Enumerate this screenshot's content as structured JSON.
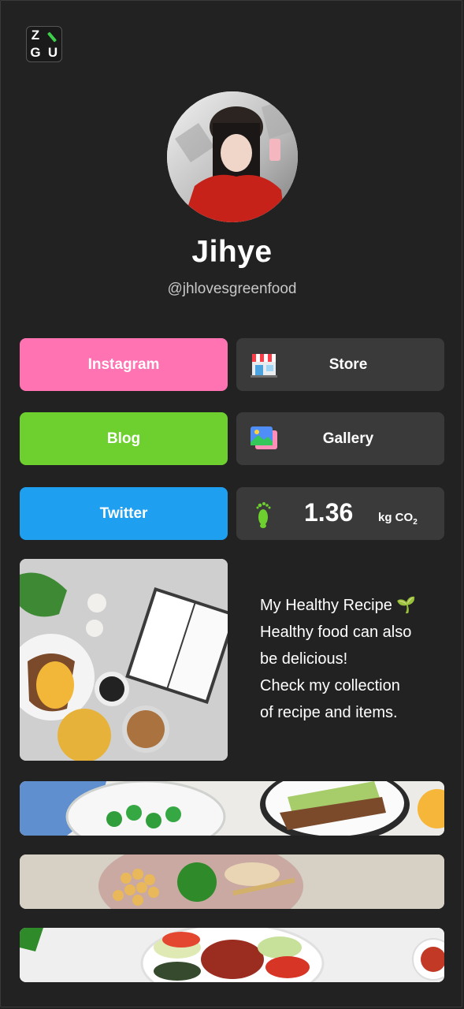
{
  "logo": {
    "letters": [
      "Z",
      "",
      "G",
      "U"
    ]
  },
  "profile": {
    "name": "Jihye",
    "handle": "@jhlovesgreenfood"
  },
  "links": {
    "instagram": "Instagram",
    "blog": "Blog",
    "twitter": "Twitter",
    "store": "Store",
    "gallery": "Gallery"
  },
  "footprint": {
    "value": "1.36",
    "unit": "kg CO",
    "unit_sub": "2"
  },
  "feature": {
    "lines": [
      "My Healthy Recipe 🌱",
      "Healthy food can also",
      "be delicious!",
      "Check my collection",
      "of recipe and items."
    ]
  },
  "colors": {
    "instagram": "#ff73b3",
    "blog": "#6dd02f",
    "twitter": "#1e9ff0",
    "tile": "#3a3a3a",
    "background": "#222222"
  }
}
